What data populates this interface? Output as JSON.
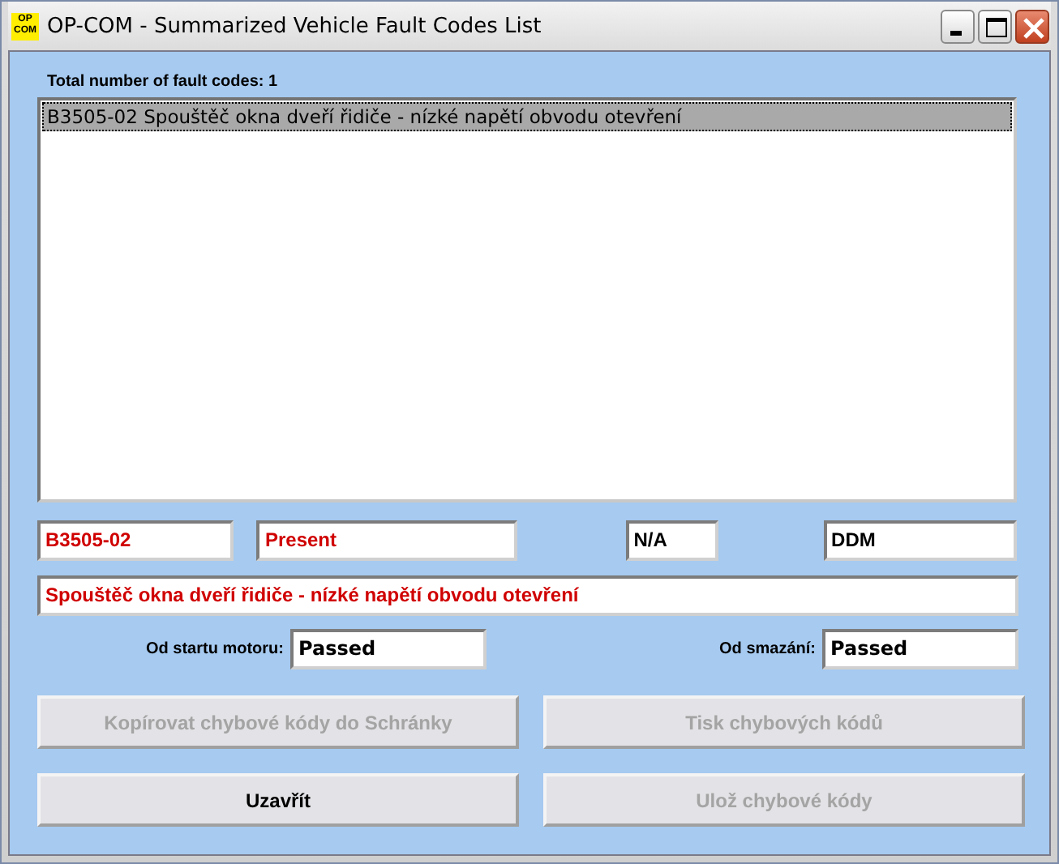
{
  "window": {
    "title": "OP-COM - Summarized Vehicle Fault Codes List",
    "icon_text": [
      "OP",
      "COM"
    ]
  },
  "total_label": "Total number of fault codes: 1",
  "fault_list": [
    {
      "text": "B3505-02 Spouštěč okna dveří řidiče - nízké napětí obvodu otevření",
      "selected": true
    }
  ],
  "code_fields": [
    {
      "value": "B3505-02",
      "alert": true
    },
    {
      "value": "Present",
      "alert": true
    },
    {
      "value": "N/A",
      "alert": false
    },
    {
      "value": "DDM",
      "alert": false
    }
  ],
  "description": {
    "value": "Spouštěč okna dveří řidiče - nízké napětí obvodu otevření",
    "alert": true
  },
  "status_fields": [
    {
      "label": "Od startu motoru:",
      "value": "Passed"
    },
    {
      "label": "Od smazání:",
      "value": "Passed"
    }
  ],
  "buttons": [
    {
      "label": "Kopírovat chybové kódy do Schránky",
      "disabled": true
    },
    {
      "label": "Tisk chybových kódů",
      "disabled": true
    },
    {
      "label": "Uzavřít",
      "disabled": false
    },
    {
      "label": "Ulož chybové kódy",
      "disabled": true
    }
  ]
}
